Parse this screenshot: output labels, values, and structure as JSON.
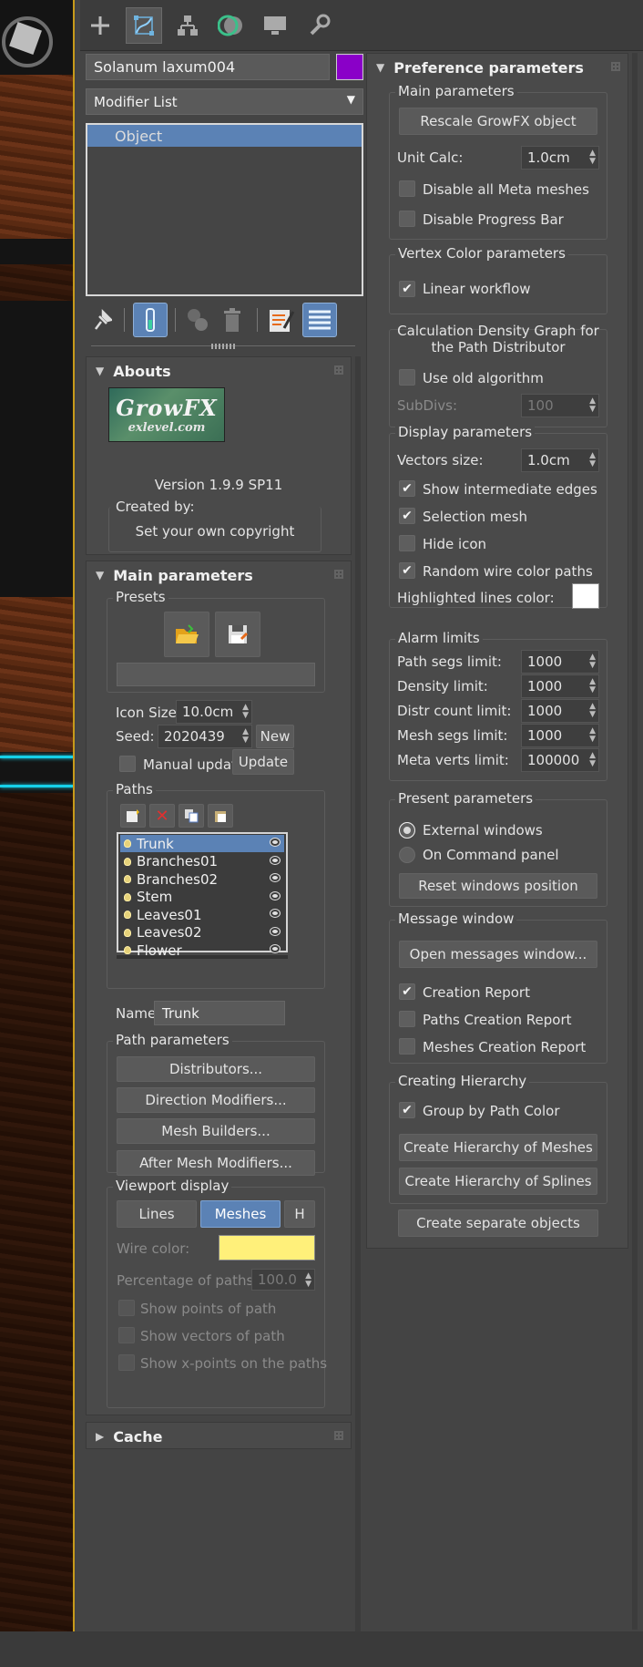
{
  "object_name": "Solanum laxum004",
  "object_color": "#8a00c8",
  "modifier_list_label": "Modifier List",
  "stack_items": [
    "Object"
  ],
  "abouts": {
    "title": "Abouts",
    "logo_main": "GrowFX",
    "logo_sub": "exlevel.com",
    "version": "Version 1.9.9 SP11",
    "created_by_label": "Created by:",
    "copyright": "Set your own copyright"
  },
  "main": {
    "title": "Main parameters",
    "presets_label": "Presets",
    "icon_size_label": "Icon Size:",
    "icon_size_value": "10.0cm",
    "seed_label": "Seed:",
    "seed_value": "2020439",
    "new_label": "New",
    "manual_update_label": "Manual update",
    "update_label": "Update",
    "paths_label": "Paths",
    "paths": [
      "Trunk",
      "Branches01",
      "Branches02",
      "Stem",
      "Leaves01",
      "Leaves02",
      "Flower"
    ],
    "name_label": "Name:",
    "name_value": "Trunk",
    "path_params_label": "Path parameters",
    "distributors": "Distributors...",
    "direction_modifiers": "Direction Modifiers...",
    "mesh_builders": "Mesh Builders...",
    "after_mesh": "After Mesh Modifiers...",
    "viewport_label": "Viewport display",
    "lines": "Lines",
    "meshes": "Meshes",
    "h": "H",
    "wire_color_label": "Wire color:",
    "wire_color": "#fff07a",
    "percentage_label": "Percentage of paths:",
    "percentage_value": "100.0",
    "show_points": "Show points of path",
    "show_vectors": "Show vectors of path",
    "show_xpoints": "Show x-points on the paths"
  },
  "cache_title": "Cache",
  "pref": {
    "title": "Preference parameters",
    "main_label": "Main parameters",
    "rescale": "Rescale GrowFX object",
    "unit_calc_label": "Unit Calc:",
    "unit_calc_value": "1.0cm",
    "disable_meta": "Disable all Meta meshes",
    "disable_progress": "Disable Progress Bar",
    "vertex_label": "Vertex Color parameters",
    "linear_workflow": "Linear workflow",
    "density_label_1": "Calculation Density Graph for",
    "density_label_2": "the Path Distributor",
    "use_old": "Use old algorithm",
    "subdivs_label": "SubDivs:",
    "subdivs_value": "100",
    "display_label": "Display parameters",
    "vectors_size_label": "Vectors size:",
    "vectors_size_value": "1.0cm",
    "show_intermediate": "Show intermediate edges",
    "selection_mesh": "Selection mesh",
    "hide_icon": "Hide icon",
    "random_wire": "Random wire color paths",
    "highlighted_label": "Highlighted lines color:",
    "highlighted_color": "#ffffff",
    "alarm_label": "Alarm limits",
    "path_segs_label": "Path segs limit:",
    "path_segs_value": "1000",
    "density_limit_label": "Density limit:",
    "density_limit_value": "1000",
    "distr_label": "Distr count limit:",
    "distr_value": "1000",
    "mesh_segs_label": "Mesh segs limit:",
    "mesh_segs_value": "1000",
    "meta_verts_label": "Meta verts limit:",
    "meta_verts_value": "100000",
    "present_label": "Present parameters",
    "external_windows": "External windows",
    "on_command_panel": "On Command panel",
    "reset_windows": "Reset windows position",
    "message_label": "Message window",
    "open_messages": "Open messages window...",
    "creation_report": "Creation Report",
    "paths_creation_report": "Paths Creation Report",
    "meshes_creation_report": "Meshes Creation Report",
    "hierarchy_label": "Creating Hierarchy",
    "group_by_color": "Group by Path Color",
    "create_meshes": "Create Hierarchy of Meshes",
    "create_splines": "Create Hierarchy of Splines",
    "create_separate": "Create separate objects"
  },
  "colors": {
    "accent": "#5b82b5",
    "viewport_border": "#c79a1a",
    "cyan_line": "#16d0e8"
  }
}
